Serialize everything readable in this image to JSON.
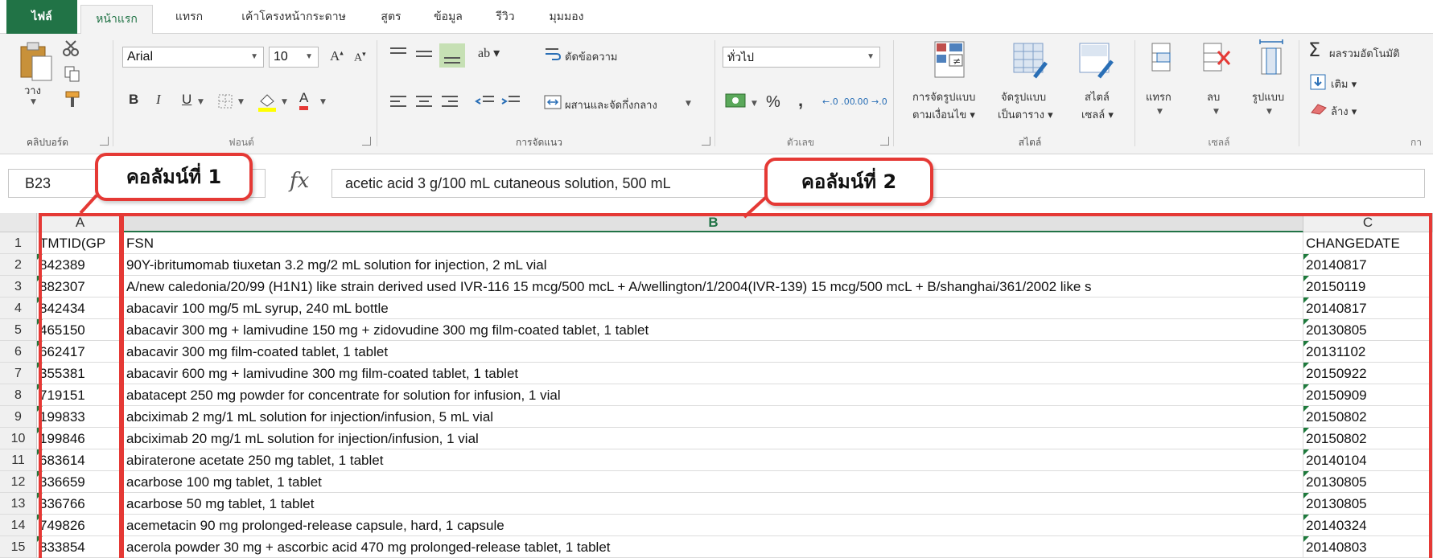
{
  "ribbon_tabs": [
    "ไฟล์",
    "หน้าแรก",
    "แทรก",
    "เค้าโครงหน้ากระดาษ",
    "สูตร",
    "ข้อมูล",
    "รีวิว",
    "มุมมอง"
  ],
  "active_tab": "หน้าแรก",
  "clipboard": {
    "paste": "วาง",
    "group": "คลิปบอร์ด"
  },
  "font": {
    "name": "Arial",
    "size": "10",
    "bold": "B",
    "italic": "I",
    "underline": "U",
    "group": "ฟอนต์"
  },
  "alignment": {
    "wrap_text": "ตัดข้อความ",
    "merge_center": "ผสานและจัดกึ่งกลาง",
    "group": "การจัดแนว"
  },
  "number": {
    "format": "ทั่วไป",
    "percent": "%",
    "comma": ",",
    "inc_decimal": "←.0 .00",
    "dec_decimal": ".00 →.0",
    "group": "ตัวเลข"
  },
  "styles": {
    "conditional": [
      "การจัดรูปแบบ",
      "ตามเงื่อนไข ▾"
    ],
    "as_table": [
      "จัดรูปแบบ",
      "เป็นตาราง ▾"
    ],
    "cell_styles": [
      "สไตล์",
      "เซลล์ ▾"
    ],
    "group": "สไตล์"
  },
  "cells": {
    "insert": "แทรก",
    "delete": "ลบ",
    "format": "รูปแบบ",
    "group": "เซลล์"
  },
  "editing": {
    "autosum": "ผลรวมอัตโนมัติ",
    "fill": "เติม ▾",
    "clear": "ล้าง ▾",
    "group": "กา"
  },
  "formula_bar": {
    "name_box": "B23",
    "fx": "fx",
    "content": "acetic acid 3 g/100 mL cutaneous solution, 500 mL"
  },
  "columns": [
    "A",
    "B",
    "C"
  ],
  "headers": {
    "row": "1",
    "a": "TMTID(GP",
    "b": "FSN",
    "c": "CHANGEDATE"
  },
  "rows": [
    {
      "n": "2",
      "a": "842389",
      "b": "90Y-ibritumomab tiuxetan 3.2 mg/2 mL solution for injection, 2 mL vial",
      "c": "20140817"
    },
    {
      "n": "3",
      "a": "882307",
      "b": "A/new caledonia/20/99 (H1N1) like strain derived used IVR-116 15 mcg/500 mcL + A/wellington/1/2004(IVR-139) 15 mcg/500 mcL + B/shanghai/361/2002 like s",
      "c": "20150119"
    },
    {
      "n": "4",
      "a": "842434",
      "b": "abacavir 100 mg/5 mL syrup, 240 mL bottle",
      "c": "20140817"
    },
    {
      "n": "5",
      "a": "465150",
      "b": "abacavir 300 mg + lamivudine 150 mg + zidovudine 300 mg film-coated tablet, 1 tablet",
      "c": "20130805"
    },
    {
      "n": "6",
      "a": "662417",
      "b": "abacavir 300 mg film-coated tablet, 1 tablet",
      "c": "20131102"
    },
    {
      "n": "7",
      "a": "355381",
      "b": "abacavir 600 mg + lamivudine 300 mg film-coated tablet, 1 tablet",
      "c": "20150922"
    },
    {
      "n": "8",
      "a": "719151",
      "b": "abatacept 250 mg powder for concentrate for solution for infusion, 1 vial",
      "c": "20150909"
    },
    {
      "n": "9",
      "a": "199833",
      "b": "abciximab 2 mg/1 mL solution for injection/infusion, 5 mL vial",
      "c": "20150802"
    },
    {
      "n": "10",
      "a": "199846",
      "b": "abciximab 20 mg/1 mL solution for injection/infusion, 1 vial",
      "c": "20150802"
    },
    {
      "n": "11",
      "a": "683614",
      "b": "abiraterone acetate 250 mg tablet, 1 tablet",
      "c": "20140104"
    },
    {
      "n": "12",
      "a": "336659",
      "b": "acarbose 100 mg tablet, 1 tablet",
      "c": "20130805"
    },
    {
      "n": "13",
      "a": "336766",
      "b": "acarbose 50 mg tablet, 1 tablet",
      "c": "20130805"
    },
    {
      "n": "14",
      "a": "749826",
      "b": "acemetacin 90 mg prolonged-release capsule, hard, 1 capsule",
      "c": "20140324"
    },
    {
      "n": "15",
      "a": "833854",
      "b": "acerola powder 30 mg + ascorbic acid 470 mg prolonged-release tablet, 1 tablet",
      "c": "20140803"
    }
  ],
  "annotations": {
    "column1": "คอลัมน์ที่ 1",
    "column2": "คอลัมน์ที่ 2",
    "color": "#e53935"
  },
  "colors": {
    "excel_green": "#217346",
    "highlight": "#e53935"
  }
}
